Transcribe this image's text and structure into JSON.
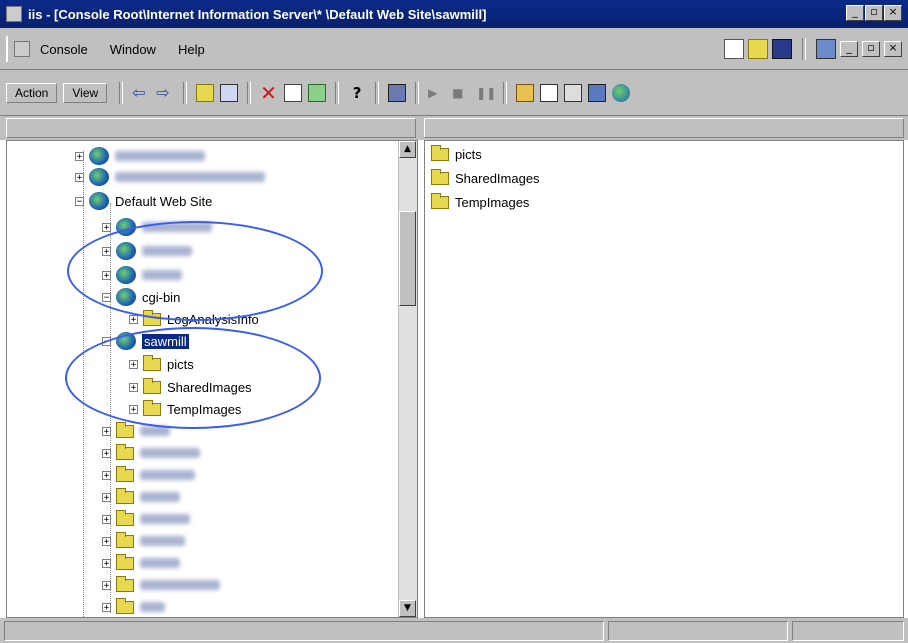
{
  "window": {
    "title": "iis - [Console Root\\Internet Information Server\\*         \\Default Web Site\\sawmill]"
  },
  "menu": {
    "items": [
      "Console",
      "Window",
      "Help"
    ]
  },
  "actionbar": {
    "action_label": "Action",
    "view_label": "View"
  },
  "tree": {
    "items": [
      {
        "label": "Default Web Site",
        "type": "website"
      },
      {
        "label": "cgi-bin",
        "type": "virtual-directory"
      },
      {
        "label": "LogAnalysisInfo",
        "type": "folder"
      },
      {
        "label": "sawmill",
        "type": "virtual-directory",
        "selected": true
      },
      {
        "label": "picts",
        "type": "folder"
      },
      {
        "label": "SharedImages",
        "type": "folder"
      },
      {
        "label": "TempImages",
        "type": "folder"
      }
    ]
  },
  "list": {
    "items": [
      "picts",
      "SharedImages",
      "TempImages"
    ]
  },
  "colors": {
    "titlebar": "#0a2a8a",
    "annotation_circle": "#3a5cf0",
    "folder": "#e8d850"
  }
}
